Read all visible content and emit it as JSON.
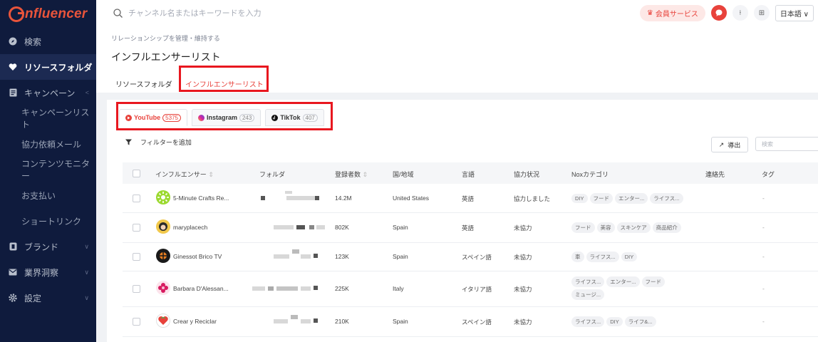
{
  "app": {
    "logo_text": "nfluencer"
  },
  "sidebar": {
    "items": [
      {
        "label": "検索",
        "icon": "compass-icon"
      },
      {
        "label": "リソースフォルダ",
        "icon": "heart-icon"
      },
      {
        "label": "キャンペーン",
        "icon": "document-icon"
      },
      {
        "label": "キャンペーンリスト"
      },
      {
        "label": "協力依頼メール"
      },
      {
        "label": "コンテンツモニター"
      },
      {
        "label": "お支払い"
      },
      {
        "label": "ショートリンク"
      },
      {
        "label": "ブランド",
        "icon": "brand-icon"
      },
      {
        "label": "業界洞察",
        "icon": "mail-icon"
      },
      {
        "label": "設定",
        "icon": "gear-icon"
      }
    ]
  },
  "topbar": {
    "search_placeholder": "チャンネル名またはキーワードを入力",
    "member_label": "会員サービス",
    "language": "日本語"
  },
  "header": {
    "breadcrumb": "リレーションシップを管理・維持する",
    "title": "インフルエンサーリスト",
    "tabs": [
      "リソースフォルダ",
      "インフルエンサーリスト"
    ]
  },
  "platform_tabs": [
    {
      "label": "YouTube",
      "count": "5375"
    },
    {
      "label": "Instagram",
      "count": "243"
    },
    {
      "label": "TikTok",
      "count": "407"
    }
  ],
  "toolbar": {
    "filter_label": "フィルターを追加",
    "export_label": "導出",
    "search_placeholder": "検索"
  },
  "table": {
    "headers": [
      "インフルエンサー",
      "フォルダ",
      "登録者数",
      "国/地域",
      "言語",
      "協力状況",
      "Noxカテゴリ",
      "連絡先",
      "タグ"
    ],
    "rows": [
      {
        "name": "5-Minute Crafts Re...",
        "subs": "14.2M",
        "country": "United States",
        "lang": "英語",
        "status": "協力しました",
        "cats": [
          "DIY",
          "フード",
          "エンター...",
          "ライフス..."
        ],
        "tags": "-"
      },
      {
        "name": "maryplacech",
        "subs": "802K",
        "country": "Spain",
        "lang": "英語",
        "status": "未協力",
        "cats": [
          "フード",
          "美容",
          "スキンケア",
          "商品紹介"
        ],
        "tags": "-"
      },
      {
        "name": "Ginessot Brico TV",
        "subs": "123K",
        "country": "Spain",
        "lang": "スペイン語",
        "status": "未協力",
        "cats": [
          "車",
          "ライフス...",
          "DIY"
        ],
        "tags": "-"
      },
      {
        "name": "Barbara D'Alessan...",
        "subs": "225K",
        "country": "Italy",
        "lang": "イタリア語",
        "status": "未協力",
        "cats": [
          "ライフス...",
          "エンター...",
          "フード",
          "ミュージ..."
        ],
        "tags": "-"
      },
      {
        "name": "Crear y Reciclar",
        "subs": "210K",
        "country": "Spain",
        "lang": "スペイン語",
        "status": "未協力",
        "cats": [
          "ライフス...",
          "DIY",
          "ライフ&..."
        ],
        "tags": "-"
      }
    ]
  },
  "colors": {
    "accent": "#e8423b",
    "sidebar_bg": "#0f1b3d",
    "highlight_box": "#e8171f"
  }
}
